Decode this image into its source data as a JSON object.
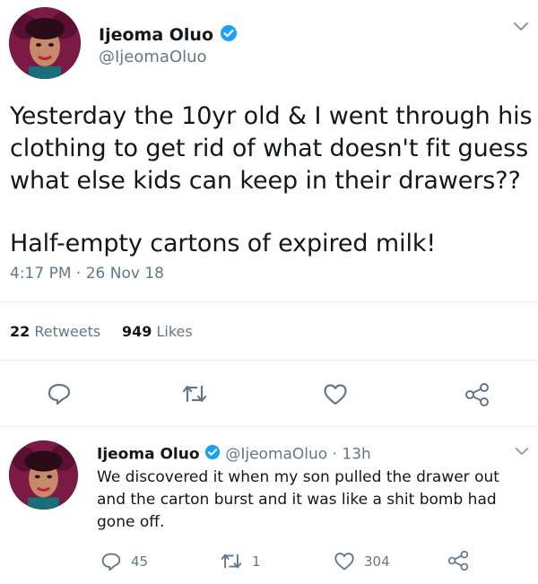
{
  "main_tweet": {
    "author_name": "Ijeoma Oluo",
    "author_handle": "@IjeomaOluo",
    "text_lines": [
      "Yesterday the 10yr old & I went through his",
      "clothing to get rid of what doesn't fit guess",
      "what else kids can keep in their drawers??",
      "Half-empty cartons of expired milk!"
    ],
    "timestamp": "4:17 PM · 26 Nov 18",
    "retweets_count": "22",
    "retweets_label": "Retweets",
    "likes_count": "949",
    "likes_label": "Likes"
  },
  "reply_tweet": {
    "author_name": "Ijeoma Oluo",
    "author_handle": "@IjeomaOluo",
    "time_ago": "· 13h",
    "text_lines": [
      "We discovered it when my son pulled the drawer out",
      "and the carton burst and it was like a shit bomb had",
      "gone off."
    ],
    "reply_count": "45",
    "retweet_count": "1",
    "like_count": "304"
  },
  "colors": {
    "verified": "#1da1f2",
    "muted": "#657786",
    "divider": "#e6ecf0",
    "avatar_bg": "#7a1a45"
  }
}
